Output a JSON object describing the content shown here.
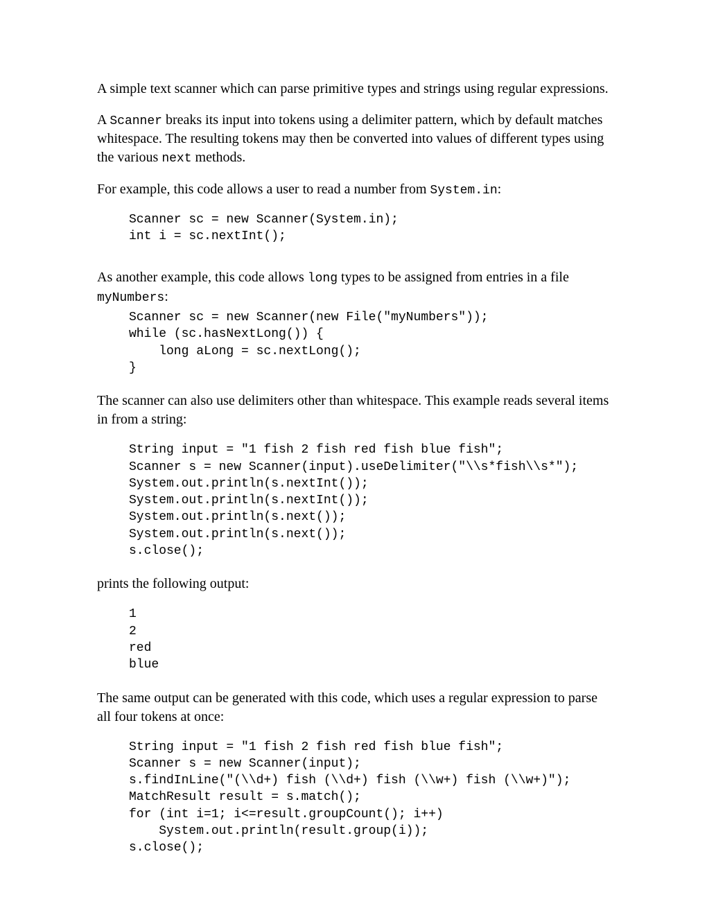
{
  "p1": "A simple text scanner which can parse primitive types and strings using regular expressions.",
  "p2a": "A ",
  "p2_code1": "Scanner",
  "p2b": " breaks its input into tokens using a delimiter pattern, which by default matches whitespace. The resulting tokens may then be converted into values of different types using the various ",
  "p2_code2": "next",
  "p2c": " methods.",
  "p3a": "For example, this code allows a user to read a number from ",
  "p3_code1": "System.in",
  "p3b": ":",
  "code1": "Scanner sc = new Scanner(System.in);\nint i = sc.nextInt();",
  "p4a": "As another example, this code allows ",
  "p4_code1": "long",
  "p4b": " types to be assigned from entries in a file ",
  "p4_code2": "myNumbers",
  "p4c": ":",
  "code2": "Scanner sc = new Scanner(new File(\"myNumbers\"));\nwhile (sc.hasNextLong()) {\n    long aLong = sc.nextLong();\n}",
  "p5": "The scanner can also use delimiters other than whitespace. This example reads several items in from a string:",
  "code3": "String input = \"1 fish 2 fish red fish blue fish\";\nScanner s = new Scanner(input).useDelimiter(\"\\\\s*fish\\\\s*\");\nSystem.out.println(s.nextInt());\nSystem.out.println(s.nextInt());\nSystem.out.println(s.next());\nSystem.out.println(s.next());\ns.close();",
  "p6": "prints the following output:",
  "code4": "1\n2\nred\nblue",
  "p7": "The same output can be generated with this code, which uses a regular expression to parse all four tokens at once:",
  "code5": "String input = \"1 fish 2 fish red fish blue fish\";\nScanner s = new Scanner(input);\ns.findInLine(\"(\\\\d+) fish (\\\\d+) fish (\\\\w+) fish (\\\\w+)\");\nMatchResult result = s.match();\nfor (int i=1; i<=result.groupCount(); i++)\n    System.out.println(result.group(i));\ns.close();"
}
